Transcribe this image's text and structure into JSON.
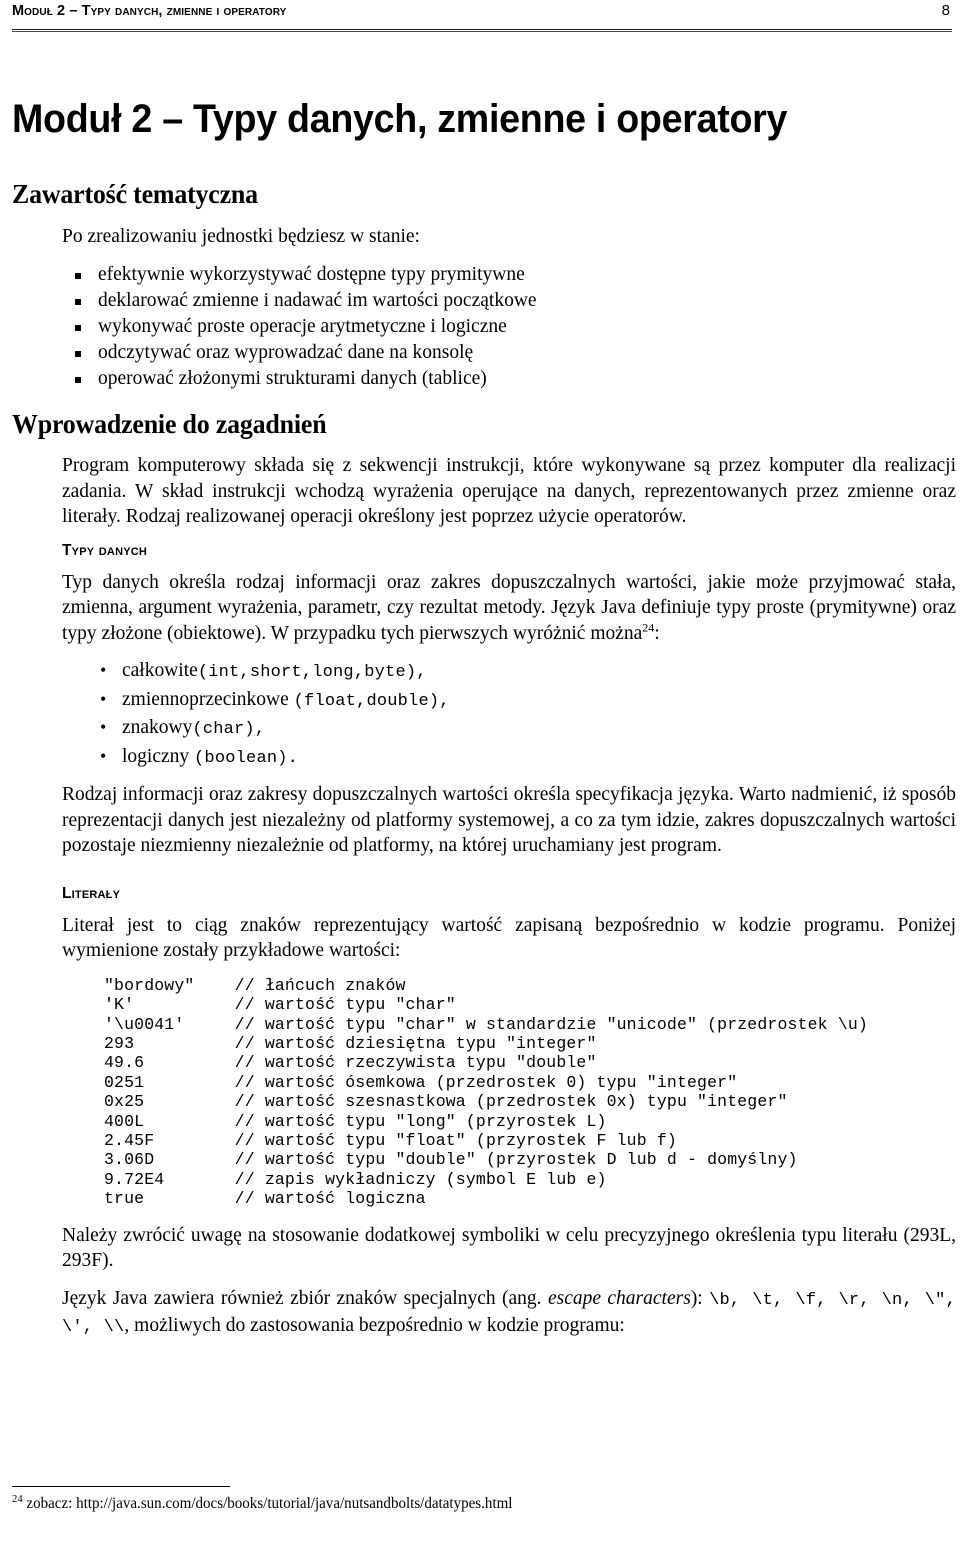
{
  "header": {
    "running_title": "Moduł 2 – Typy danych, zmienne i operatory",
    "page_number": "8"
  },
  "document": {
    "title": "Moduł 2 – Typy danych, zmienne i operatory"
  },
  "sections": {
    "zawartosc": {
      "heading": "Zawartość tematyczna",
      "intro": "Po zrealizowaniu jednostki będziesz w stanie:",
      "items": [
        "efektywnie wykorzystywać dostępne typy prymitywne",
        "deklarować zmienne i nadawać im wartości początkowe",
        "wykonywać proste operacje arytmetyczne i logiczne",
        "odczytywać oraz wyprowadzać dane na konsolę",
        "operować złożonymi strukturami danych (tablice)"
      ]
    },
    "wprowadzenie": {
      "heading": "Wprowadzenie do zagadnień",
      "paragraph": "Program komputerowy składa się z sekwencji instrukcji, które wykonywane są przez komputer dla realizacji zadania. W skład instrukcji wchodzą wyrażenia operujące na danych, reprezentowanych przez zmienne oraz literały. Rodzaj realizowanej operacji określony jest poprzez użycie operatorów."
    },
    "typy_danych": {
      "heading": "Typy danych",
      "paragraph_pre": "Typ danych określa rodzaj informacji oraz zakres dopuszczalnych wartości, jakie może przyjmować stała, zmienna, argument wyrażenia, parametr, czy rezultat metody. Język Java definiuje typy proste (prymitywne) oraz typy złożone (obiektowe). W przypadku tych pierwszych wyróżnić można",
      "footnote_marker": "24",
      "paragraph_post": ":",
      "type_items": [
        {
          "label": "całkowite",
          "code": "(int,short,long,byte),",
          "space": ""
        },
        {
          "label": "zmiennoprzecinkowe",
          "code": "(float,double),",
          "space": " "
        },
        {
          "label": "znakowy",
          "code": "(char),",
          "space": ""
        },
        {
          "label": "logiczny",
          "code": "(boolean).",
          "space": " "
        }
      ],
      "paragraph_after": "Rodzaj informacji oraz zakresy dopuszczalnych wartości określa specyfikacja języka. Warto nadmienić, iż sposób reprezentacji danych jest niezależny od platformy systemowej, a co za tym idzie, zakres dopuszczalnych wartości pozostaje niezmienny niezależnie od platformy, na której uruchamiany jest program."
    },
    "literaly": {
      "heading": "Literały",
      "paragraph": "Literał jest to ciąg znaków reprezentujący wartość zapisaną bezpośrednio w kodzie programu. Poniżej wymienione zostały przykładowe wartości:",
      "code_block": "\"bordowy\"    // łańcuch znaków\n'K'          // wartość typu \"char\"\n'\\u0041'     // wartość typu \"char\" w standardzie \"unicode\" (przedrostek \\u)\n293          // wartość dziesiętna typu \"integer\"\n49.6         // wartość rzeczywista typu \"double\"\n0251         // wartość ósemkowa (przedrostek 0) typu \"integer\"\n0x25         // wartość szesnastkowa (przedrostek 0x) typu \"integer\"\n400L         // wartość typu \"long\" (przyrostek L)\n2.45F        // wartość typu \"float\" (przyrostek F lub f)\n3.06D        // wartość typu \"double\" (przyrostek D lub d - domyślny)\n9.72E4       // zapis wykładniczy (symbol E lub e)\ntrue         // wartość logiczna",
      "paragraph_note": "Należy zwrócić uwagę na stosowanie dodatkowej symboliki w celu precyzyjnego określenia typu literału (293L, 293F).",
      "escape_pre": "Język Java zawiera również zbiór znaków specjalnych (ang. ",
      "escape_italic": "escape characters",
      "escape_mid": "): ",
      "escape_codes": "\\b, \\t, \\f, \\r, \\n, \\\", \\', \\\\",
      "escape_post": ", możliwych do zastosowania bezpośrednio w kodzie programu:"
    }
  },
  "footnote": {
    "number": "24",
    "text": "zobacz: http://java.sun.com/docs/books/tutorial/java/nutsandbolts/datatypes.html"
  }
}
